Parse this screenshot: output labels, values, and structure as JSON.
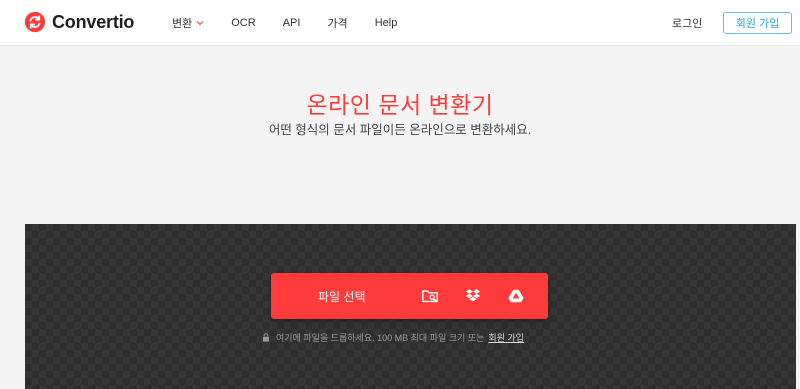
{
  "brand": {
    "name": "Convertio",
    "color": "#ff3a3a"
  },
  "nav": {
    "items": [
      {
        "label": "변환",
        "has_dropdown": true
      },
      {
        "label": "OCR"
      },
      {
        "label": "API"
      },
      {
        "label": "가격"
      },
      {
        "label": "Help"
      }
    ]
  },
  "auth": {
    "login_label": "로그인",
    "signup_label": "회원 가입",
    "signup_color": "#2aa8d8"
  },
  "hero": {
    "title": "온라인 문서 변환기",
    "subtitle": "어떤 형식의 문서 파일이든 온라인으로 변환하세요."
  },
  "upload": {
    "choose_label": "파일 선택",
    "sources": [
      {
        "icon": "folder-search-icon"
      },
      {
        "icon": "dropbox-icon"
      },
      {
        "icon": "google-drive-icon"
      }
    ],
    "hint_text": "여기에 파일을 드롭하세요. 100 MB 최대 파일 크기 또는",
    "hint_link": "회원 가입"
  }
}
